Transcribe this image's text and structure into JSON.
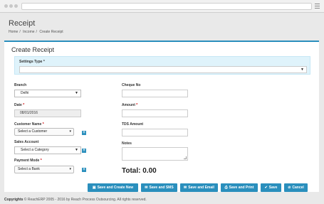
{
  "page": {
    "title": "Receipt",
    "breadcrumb": [
      "Home",
      "Income",
      "Create Receipt"
    ],
    "breadcrumb_sep": "/"
  },
  "form": {
    "title": "Create Receipt",
    "settings_type": {
      "label": "Settings Type",
      "required": "*",
      "value": ""
    },
    "branch": {
      "label": "Branch",
      "value": "Delhi"
    },
    "date": {
      "label": "Date",
      "required": "*",
      "value": "08/01/2016"
    },
    "customer_name": {
      "label": "Customer Name",
      "required": "*",
      "value": "Select a Customer"
    },
    "sales_account": {
      "label": "Sales Account",
      "value": "Select a Category"
    },
    "payment_mode": {
      "label": "Payment Mode",
      "required": "*",
      "value": "Select a Bank"
    },
    "cheque_no": {
      "label": "Cheque No",
      "value": ""
    },
    "amount": {
      "label": "Amount",
      "required": "*",
      "value": ""
    },
    "tds_amount": {
      "label": "TDS Amount",
      "value": ""
    },
    "notes": {
      "label": "Notes",
      "value": ""
    },
    "total": "Total: 0.00"
  },
  "buttons": {
    "save_create_new": "Save and Create New",
    "save_sms": "Save and SMS",
    "save_email": "Save and Email",
    "save_print": "Save and Print",
    "save": "Save",
    "cancel": "Cancel"
  },
  "footer": {
    "prefix": "Copyrights",
    "text": "© ReachERP 2005 - 2016 by Reach Process Outsourcing. All rights reserved."
  },
  "colors": {
    "accent": "#2a8fbd",
    "settings_bg": "#dff3fb"
  },
  "icons": [
    "menu-icon",
    "plus-icon",
    "check-icon",
    "comment-icon",
    "envelope-icon",
    "print-icon",
    "cancel-icon",
    "caret-down-icon"
  ]
}
